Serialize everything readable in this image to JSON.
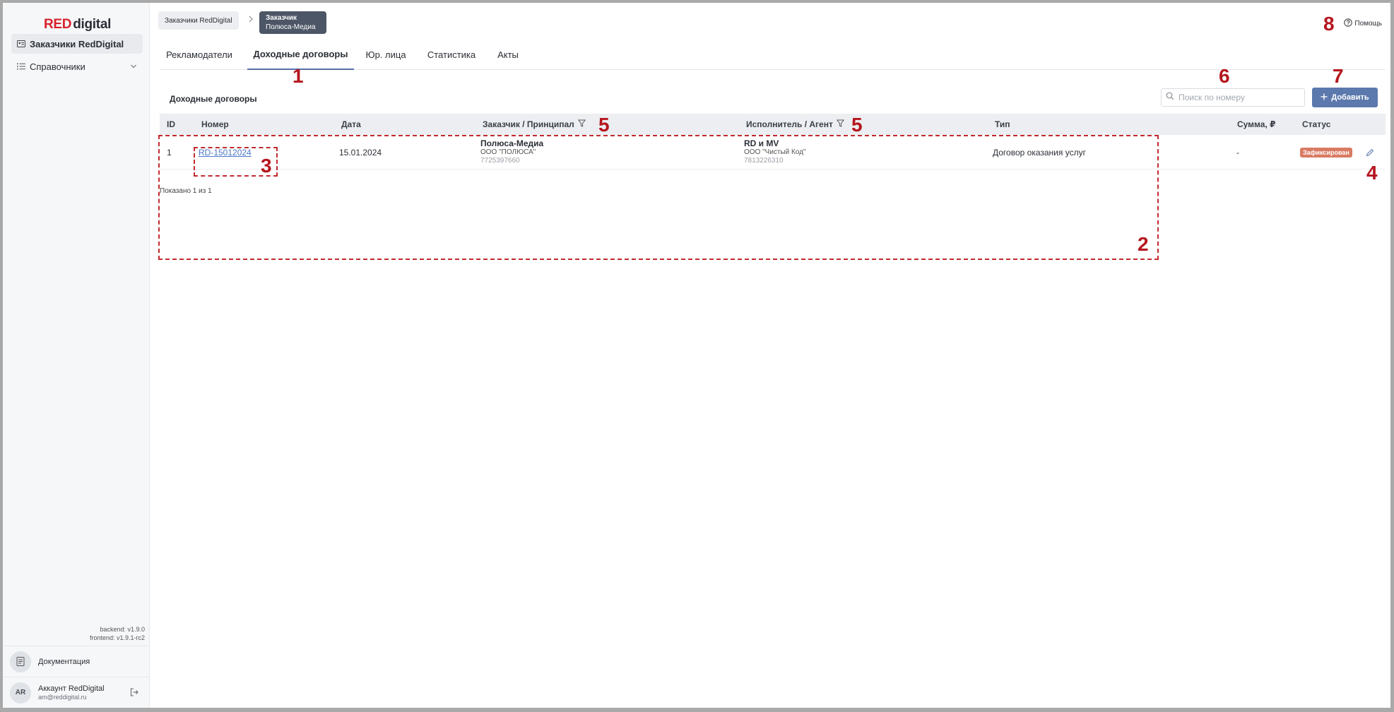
{
  "logo": {
    "red": "RED",
    "rest": "digital"
  },
  "sidebar": {
    "items": [
      {
        "label": "Заказчики RedDigital"
      },
      {
        "label": "Справочники"
      }
    ],
    "versions": {
      "backend": "backend: v1.9.0",
      "frontend": "frontend: v1.9.1-rc2"
    },
    "docs_label": "Документация",
    "account": {
      "initials": "AR",
      "name": "Аккаунт RedDigital",
      "email": "am@reddigital.ru"
    }
  },
  "breadcrumb": {
    "first": "Заказчики RedDigital",
    "current_title": "Заказчик",
    "current_sub": "Полюса-Медиа"
  },
  "help_label": "Помощь",
  "tabs": [
    {
      "label": "Рекламодатели"
    },
    {
      "label": "Доходные договоры"
    },
    {
      "label": "Юр. лица"
    },
    {
      "label": "Статистика"
    },
    {
      "label": "Акты"
    }
  ],
  "card": {
    "title": "Доходные договоры",
    "search_placeholder": "Поиск по номеру",
    "add_label": "Добавить"
  },
  "table": {
    "columns": [
      "ID",
      "Номер",
      "Дата",
      "Заказчик / Принципал",
      "Исполнитель / Агент",
      "Тип",
      "Сумма, ₽",
      "Статус"
    ],
    "rows": [
      {
        "id": "1",
        "number": "RD-15012024",
        "date": "15.01.2024",
        "customer_name": "Полюса-Медиа",
        "customer_legal": "ООО \"ПОЛЮСА\"",
        "customer_inn": "7725397660",
        "agent_name": "RD и MV",
        "agent_legal": "ООО \"Чистый Код\"",
        "agent_inn": "7813226310",
        "type": "Договор оказания услуг",
        "sum": "-",
        "status": "Зафиксирован"
      }
    ],
    "shown_text": "Показано 1 из 1"
  },
  "annotations": [
    "1",
    "2",
    "3",
    "4",
    "5",
    "5",
    "6",
    "7",
    "8"
  ],
  "colors": {
    "brand_red": "#d6222b",
    "accent": "#5c79ad",
    "status": "#d97b63",
    "annotation": "#b5161e"
  }
}
